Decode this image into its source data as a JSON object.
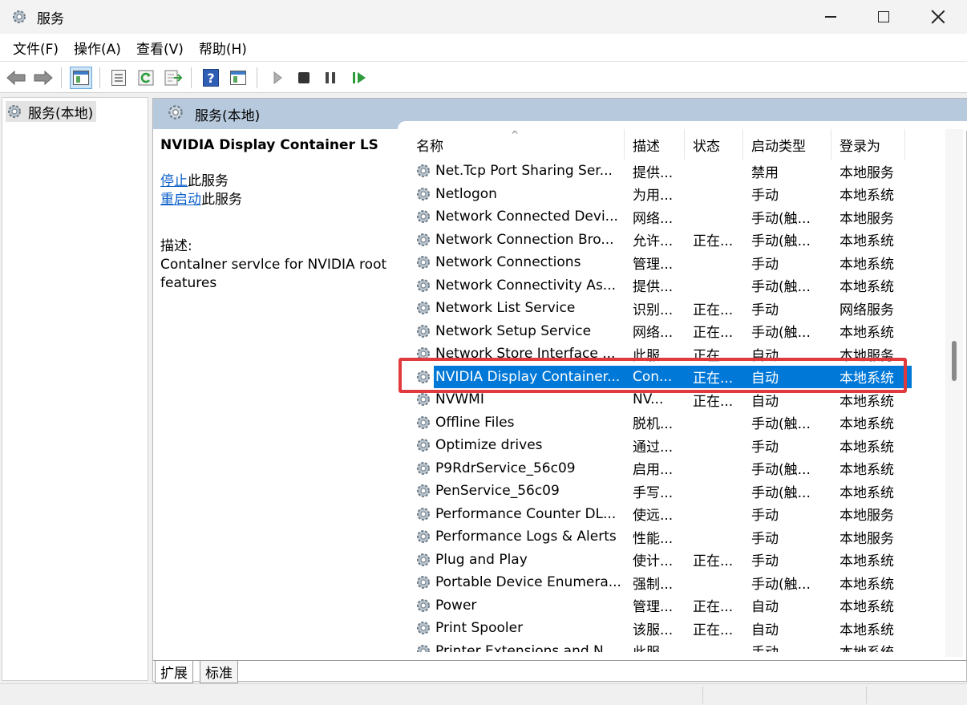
{
  "window": {
    "title": "服务"
  },
  "menubar": {
    "items": [
      "文件(F)",
      "操作(A)",
      "查看(V)",
      "帮助(H)"
    ]
  },
  "toolbar": {
    "buttons": [
      "back-icon",
      "forward-icon",
      "show-hide-tree-icon",
      "properties-icon",
      "refresh-icon",
      "export-list-icon",
      "help-icon",
      "console-tree-icon",
      "start-service-icon",
      "stop-service-icon",
      "pause-service-icon",
      "resume-service-icon"
    ]
  },
  "tree": {
    "root_label": "服务(本地)"
  },
  "pane": {
    "header_label": "服务(本地)",
    "selected_service_title": "NVIDIA Display Container LS",
    "stop_link": "停止",
    "stop_suffix": "此服务",
    "restart_link": "重启动",
    "restart_suffix": "此服务",
    "desc_label": "描述:",
    "desc_text": "Contalner servlce for NVIDIA root features"
  },
  "table": {
    "columns": {
      "name": "名称",
      "desc": "描述",
      "status": "状态",
      "startup": "启动类型",
      "logon": "登录为"
    },
    "sort_indicator": "^",
    "rows": [
      {
        "name": "Net.Tcp Port Sharing Ser...",
        "desc": "提供...",
        "status": "",
        "startup": "禁用",
        "logon": "本地服务"
      },
      {
        "name": "Netlogon",
        "desc": "为用...",
        "status": "",
        "startup": "手动",
        "logon": "本地系统"
      },
      {
        "name": "Network Connected Devi...",
        "desc": "网络...",
        "status": "",
        "startup": "手动(触...",
        "logon": "本地服务"
      },
      {
        "name": "Network Connection Bro...",
        "desc": "允许...",
        "status": "正在...",
        "startup": "手动(触...",
        "logon": "本地系统"
      },
      {
        "name": "Network Connections",
        "desc": "管理...",
        "status": "",
        "startup": "手动",
        "logon": "本地系统"
      },
      {
        "name": "Network Connectivity As...",
        "desc": "提供...",
        "status": "",
        "startup": "手动(触...",
        "logon": "本地系统"
      },
      {
        "name": "Network List Service",
        "desc": "识别...",
        "status": "正在...",
        "startup": "手动",
        "logon": "网络服务"
      },
      {
        "name": "Network Setup Service",
        "desc": "网络...",
        "status": "正在...",
        "startup": "手动(触...",
        "logon": "本地系统"
      },
      {
        "name": "Network Store Interface ...",
        "desc": "此服...",
        "status": "正在...",
        "startup": "自动",
        "logon": "本地服务"
      },
      {
        "name": "NVIDIA Display Container...",
        "desc": "Con...",
        "status": "正在...",
        "startup": "自动",
        "logon": "本地系统"
      },
      {
        "name": "NVWMI",
        "desc": "NV...",
        "status": "正在...",
        "startup": "自动",
        "logon": "本地系统"
      },
      {
        "name": "Offline Files",
        "desc": "脱机...",
        "status": "",
        "startup": "手动(触...",
        "logon": "本地系统"
      },
      {
        "name": "Optimize drives",
        "desc": "通过...",
        "status": "",
        "startup": "手动",
        "logon": "本地系统"
      },
      {
        "name": "P9RdrService_56c09",
        "desc": "启用...",
        "status": "",
        "startup": "手动(触...",
        "logon": "本地系统"
      },
      {
        "name": "PenService_56c09",
        "desc": "手写...",
        "status": "",
        "startup": "手动(触...",
        "logon": "本地系统"
      },
      {
        "name": "Performance Counter DL...",
        "desc": "使远...",
        "status": "",
        "startup": "手动",
        "logon": "本地服务"
      },
      {
        "name": "Performance Logs & Alerts",
        "desc": "性能...",
        "status": "",
        "startup": "手动",
        "logon": "本地服务"
      },
      {
        "name": "Plug and Play",
        "desc": "使计...",
        "status": "正在...",
        "startup": "手动",
        "logon": "本地系统"
      },
      {
        "name": "Portable Device Enumera...",
        "desc": "强制...",
        "status": "",
        "startup": "手动(触...",
        "logon": "本地系统"
      },
      {
        "name": "Power",
        "desc": "管理...",
        "status": "正在...",
        "startup": "自动",
        "logon": "本地系统"
      },
      {
        "name": "Print Spooler",
        "desc": "该服...",
        "status": "正在...",
        "startup": "自动",
        "logon": "本地系统"
      },
      {
        "name": "Printer Extensions and N...",
        "desc": "此服...",
        "status": "",
        "startup": "手动",
        "logon": "本地系统"
      }
    ]
  },
  "tabs": [
    "扩展",
    "标准"
  ],
  "colors": {
    "selection": "#0078d7",
    "highlight": "#e0393e",
    "pane_header": "#b7c9dd",
    "link": "#0b5fc9"
  }
}
